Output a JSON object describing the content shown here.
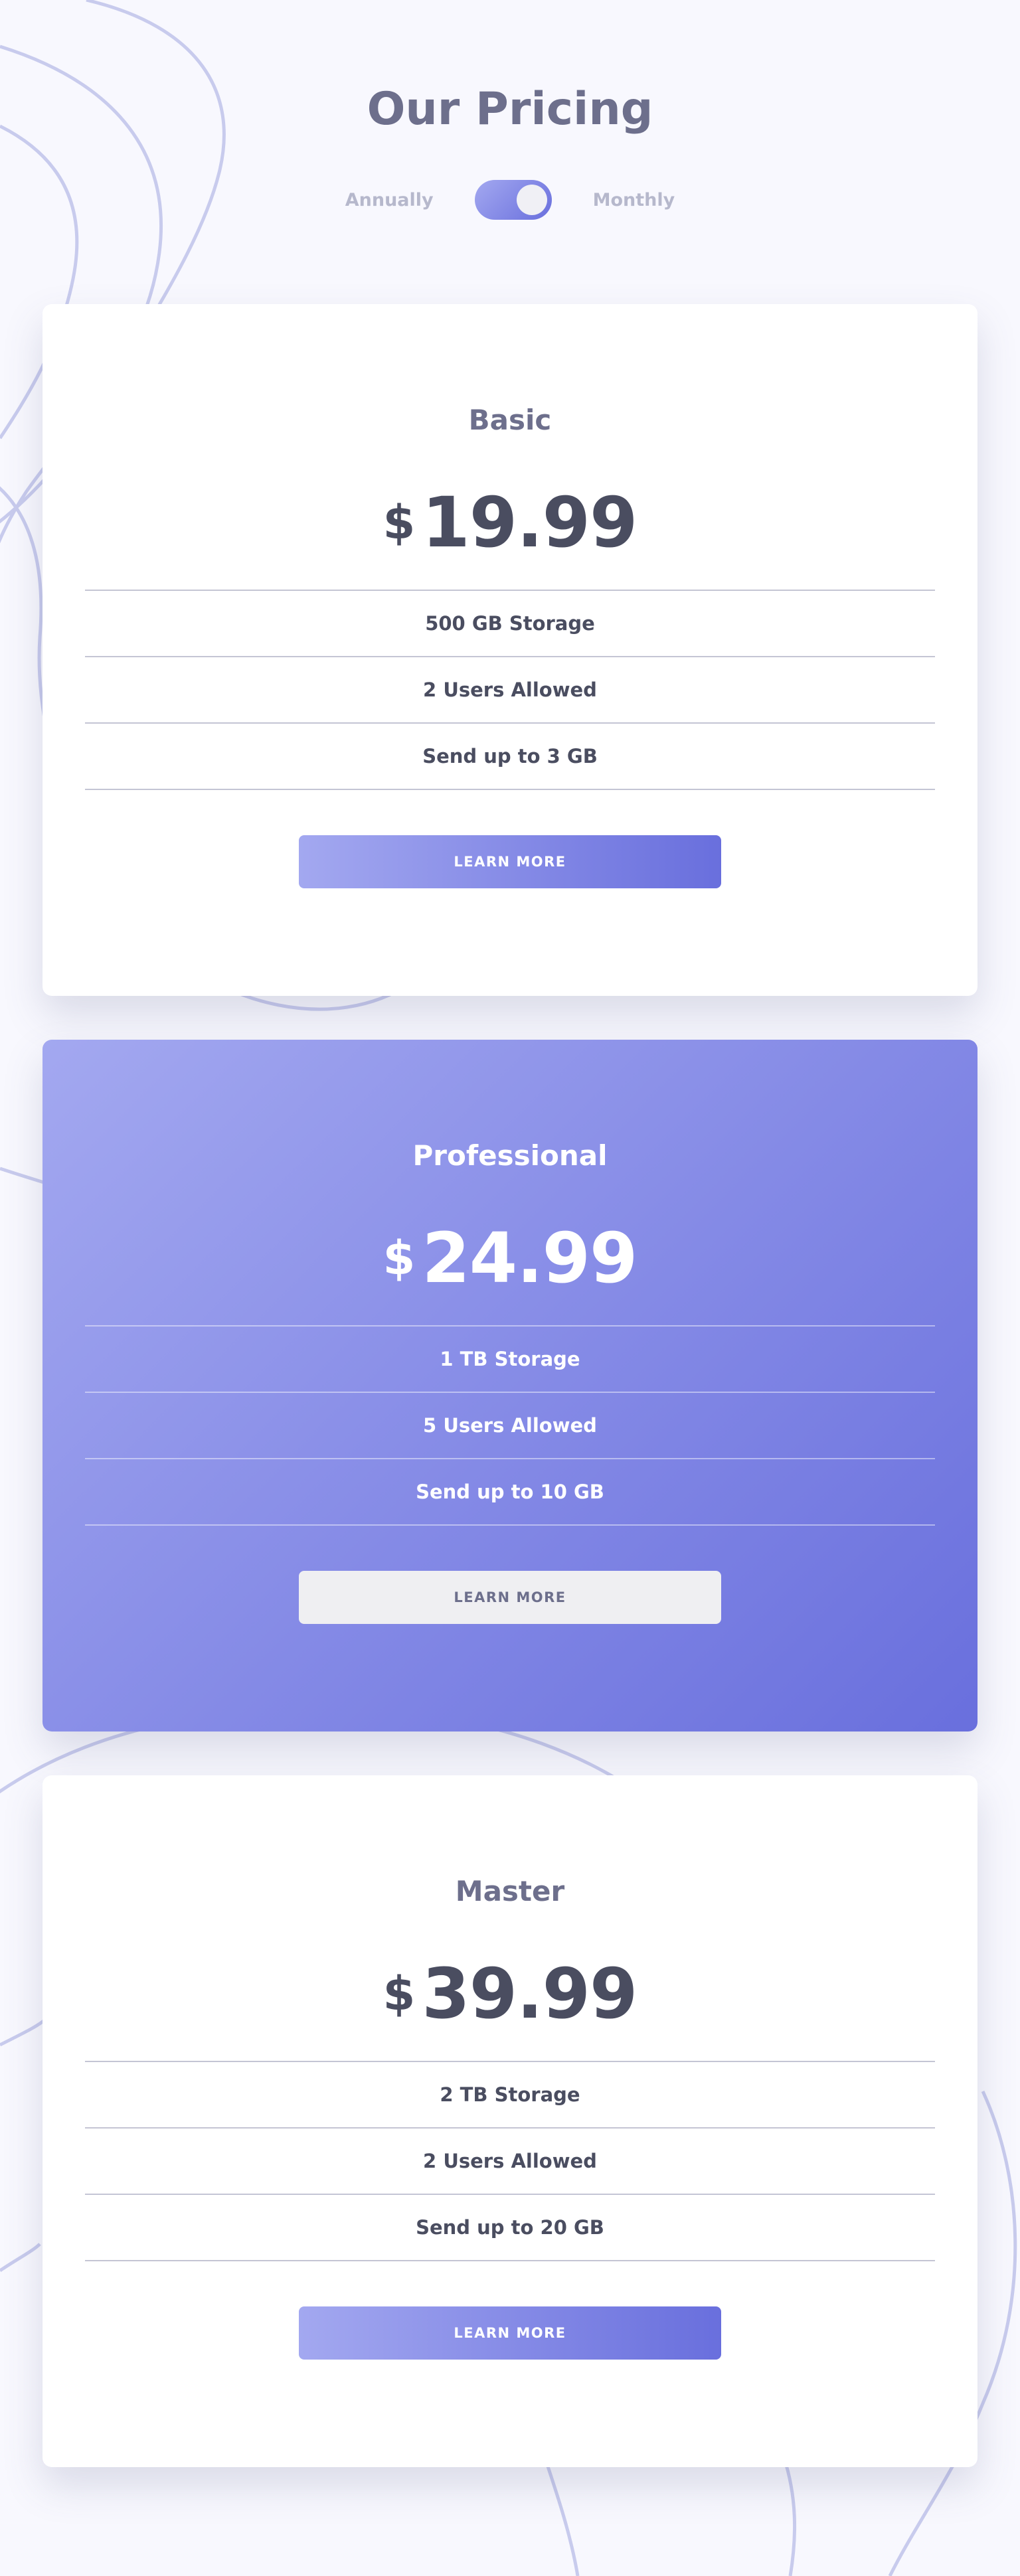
{
  "page": {
    "title": "Our Pricing"
  },
  "billing_toggle": {
    "left_label": "Annually",
    "right_label": "Monthly",
    "state": "monthly"
  },
  "colors": {
    "accent_start": "#a3a8f0",
    "accent_end": "#696fdd",
    "text_dark": "#4a4d60",
    "text_muted": "#6d6f8c",
    "background": "#f8f8fe"
  },
  "plans": [
    {
      "name": "Basic",
      "currency": "$",
      "price": "19.99",
      "features": [
        "500 GB Storage",
        "2 Users Allowed",
        "Send up to 3 GB"
      ],
      "button_label": "LEARN MORE",
      "featured": false
    },
    {
      "name": "Professional",
      "currency": "$",
      "price": "24.99",
      "features": [
        "1 TB Storage",
        "5 Users Allowed",
        "Send up to 10 GB"
      ],
      "button_label": "LEARN MORE",
      "featured": true
    },
    {
      "name": "Master",
      "currency": "$",
      "price": "39.99",
      "features": [
        "2 TB Storage",
        "2 Users Allowed",
        "Send up to 20 GB"
      ],
      "button_label": "LEARN MORE",
      "featured": false
    }
  ]
}
